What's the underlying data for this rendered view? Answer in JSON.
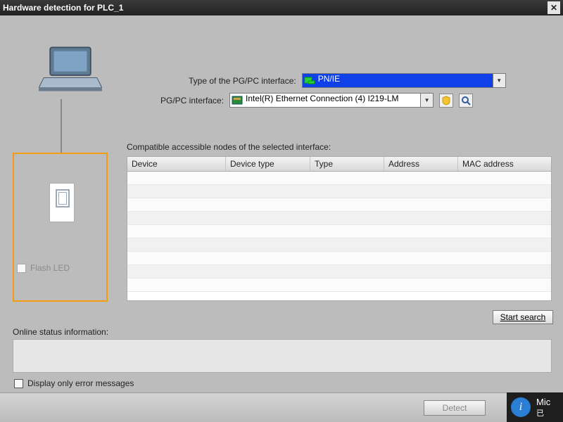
{
  "window": {
    "title": "Hardware detection for PLC_1"
  },
  "interface": {
    "type_label": "Type of the PG/PC interface:",
    "type_value": "PN/IE",
    "if_label": "PG/PC interface:",
    "if_value": "Intel(R) Ethernet Connection (4) I219-LM"
  },
  "flash_led_label": "Flash LED",
  "nodes_label": "Compatible accessible nodes of the selected interface:",
  "columns": {
    "device": "Device",
    "device_type": "Device type",
    "type": "Type",
    "address": "Address",
    "mac": "MAC address"
  },
  "buttons": {
    "start_search": "Start search",
    "detect": "Detect",
    "cancel": ""
  },
  "status_label": "Online status information:",
  "errors_only_label": "Display only error messages",
  "toast": {
    "line1": "Mic",
    "line2": "已"
  }
}
